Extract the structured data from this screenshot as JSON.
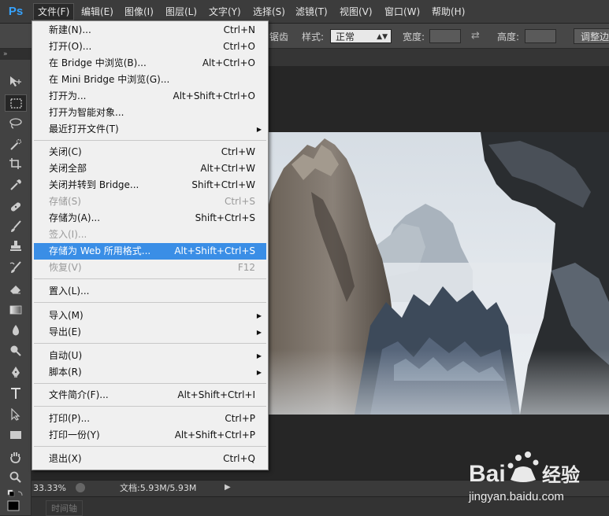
{
  "app": {
    "logo": "Ps"
  },
  "menubar": [
    {
      "label": "文件(F)",
      "active": true
    },
    {
      "label": "编辑(E)"
    },
    {
      "label": "图像(I)"
    },
    {
      "label": "图层(L)"
    },
    {
      "label": "文字(Y)"
    },
    {
      "label": "选择(S)"
    },
    {
      "label": "滤镜(T)"
    },
    {
      "label": "视图(V)"
    },
    {
      "label": "窗口(W)"
    },
    {
      "label": "帮助(H)"
    }
  ],
  "options": {
    "partial_text": "锯齿",
    "style_label": "样式:",
    "style_value": "正常",
    "width_label": "宽度:",
    "height_label": "高度:",
    "adjust_button": "调整边"
  },
  "file_menu": {
    "items": [
      {
        "label": "新建(N)...",
        "shortcut": "Ctrl+N"
      },
      {
        "label": "打开(O)...",
        "shortcut": "Ctrl+O"
      },
      {
        "label": "在 Bridge 中浏览(B)...",
        "shortcut": "Alt+Ctrl+O"
      },
      {
        "label": "在 Mini Bridge 中浏览(G)...",
        "shortcut": ""
      },
      {
        "label": "打开为...",
        "shortcut": "Alt+Shift+Ctrl+O"
      },
      {
        "label": "打开为智能对象...",
        "shortcut": ""
      },
      {
        "label": "最近打开文件(T)",
        "shortcut": "",
        "submenu": true
      },
      {
        "label": "关闭(C)",
        "shortcut": "Ctrl+W"
      },
      {
        "label": "关闭全部",
        "shortcut": "Alt+Ctrl+W"
      },
      {
        "label": "关闭并转到 Bridge...",
        "shortcut": "Shift+Ctrl+W"
      },
      {
        "label": "存储(S)",
        "shortcut": "Ctrl+S",
        "disabled": true
      },
      {
        "label": "存储为(A)...",
        "shortcut": "Shift+Ctrl+S"
      },
      {
        "label": "签入(I)...",
        "shortcut": "",
        "disabled": true
      },
      {
        "label": "存储为 Web 所用格式...",
        "shortcut": "Alt+Shift+Ctrl+S",
        "highlight": true
      },
      {
        "label": "恢复(V)",
        "shortcut": "F12",
        "disabled": true
      },
      {
        "label": "置入(L)...",
        "shortcut": ""
      },
      {
        "label": "导入(M)",
        "shortcut": "",
        "submenu": true
      },
      {
        "label": "导出(E)",
        "shortcut": "",
        "submenu": true
      },
      {
        "label": "自动(U)",
        "shortcut": "",
        "submenu": true
      },
      {
        "label": "脚本(R)",
        "shortcut": "",
        "submenu": true
      },
      {
        "label": "文件简介(F)...",
        "shortcut": "Alt+Shift+Ctrl+I"
      },
      {
        "label": "打印(P)...",
        "shortcut": "Ctrl+P"
      },
      {
        "label": "打印一份(Y)",
        "shortcut": "Alt+Shift+Ctrl+P"
      },
      {
        "label": "退出(X)",
        "shortcut": "Ctrl+Q"
      }
    ]
  },
  "status": {
    "zoom": "33.33%",
    "doc_info": "文档:5.93M/5.93M",
    "timeline": "时间轴"
  },
  "watermark": {
    "brand": "Bai",
    "brand_suffix": "经验",
    "url": "jingyan.baidu.com"
  },
  "colors": {
    "highlight": "#3a8ee6",
    "logo": "#36a3ff"
  }
}
